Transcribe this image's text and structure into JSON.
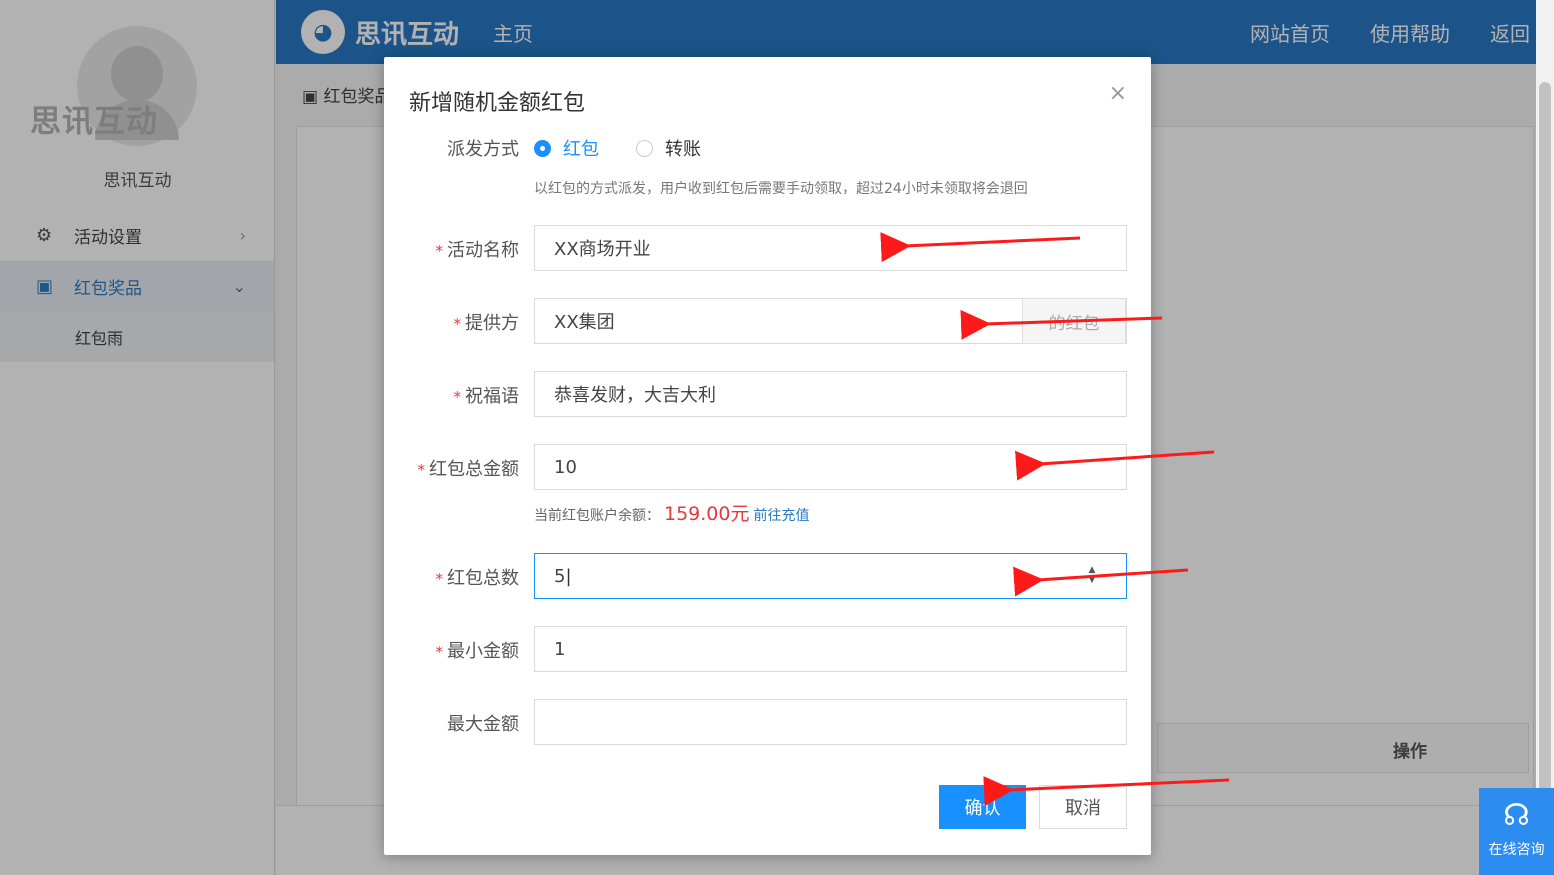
{
  "sidebar": {
    "brand": "思讯互动",
    "username": "思讯互动",
    "items": [
      {
        "label": "活动设置",
        "icon": "gears-icon"
      },
      {
        "label": "红包奖品",
        "icon": "red-packet-icon"
      }
    ],
    "sub_item": "红包雨"
  },
  "header": {
    "logo_text": "思讯互动",
    "home": "主页",
    "links": [
      "网站首页",
      "使用帮助",
      "返回"
    ]
  },
  "background": {
    "breadcrumb": "红包奖品",
    "table_op_header": "操作"
  },
  "modal": {
    "title": "新增随机金额红包",
    "close": "×",
    "method_label": "派发方式",
    "method_options": [
      "红包",
      "转账"
    ],
    "method_selected": "红包",
    "method_hint": "以红包的方式派发，用户收到红包后需要手动领取，超过24小时未领取将会退回",
    "fields": {
      "name": {
        "label": "活动名称",
        "value": "XX商场开业",
        "required": true
      },
      "provider": {
        "label": "提供方",
        "value": "XX集团",
        "addon": "的红包",
        "required": true
      },
      "greeting": {
        "label": "祝福语",
        "value": "恭喜发财，大吉大利",
        "required": true
      },
      "total_amount": {
        "label": "红包总金额",
        "value": "10",
        "required": true
      },
      "total_count": {
        "label": "红包总数",
        "value": "5",
        "required": true
      },
      "min_amount": {
        "label": "最小金额",
        "value": "1",
        "required": true
      },
      "max_amount": {
        "label": "最大金额",
        "value": "",
        "required": false
      }
    },
    "balance_prefix": "当前红包账户余额：",
    "balance_amount": "159.00元",
    "recharge_link": "前往充值",
    "confirm": "确认",
    "cancel": "取消"
  },
  "consult": {
    "label": "在线咨询",
    "icon": "headset-icon"
  },
  "colors": {
    "header": "#2979c5",
    "primary": "#1890ff",
    "required": "#e4393c",
    "arrow": "#ff1a1a"
  }
}
